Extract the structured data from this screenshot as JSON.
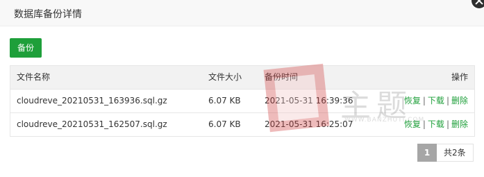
{
  "dialog": {
    "title": "数据库备份详情"
  },
  "toolbar": {
    "backup_label": "备份"
  },
  "table": {
    "columns": {
      "name": "文件名称",
      "size": "文件大小",
      "time": "备份时间",
      "ops": "操作"
    },
    "rows": [
      {
        "name": "cloudreve_20210531_163936.sql.gz",
        "size": "6.07 KB",
        "time": "2021-05-31 16:39:36",
        "restore": "恢复",
        "download": "下载",
        "delete": "删除"
      },
      {
        "name": "cloudreve_20210531_162507.sql.gz",
        "size": "6.07 KB",
        "time": "2021-05-31 16:25:07",
        "restore": "恢复",
        "download": "下载",
        "delete": "删除"
      }
    ]
  },
  "pager": {
    "current": "1",
    "total": "共2条"
  },
  "watermark": {
    "text": "主题",
    "url": "WWW.BANZHUTI.COM"
  },
  "colors": {
    "primary": "#1e9f3a",
    "header_bg": "#f8f8f8",
    "table_header_bg": "#f2f2f2",
    "pager_active": "#a6a6a6"
  }
}
